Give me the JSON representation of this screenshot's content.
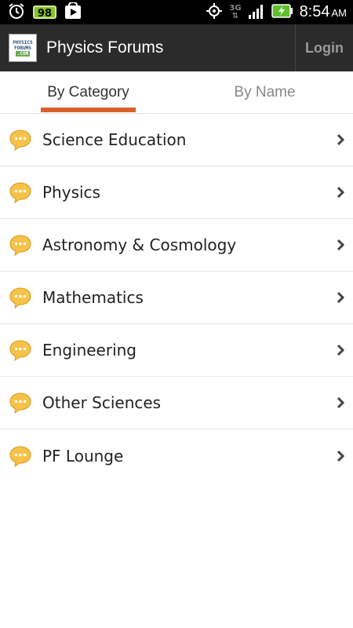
{
  "status_bar": {
    "notification_badge": "98",
    "clock": "8:54",
    "ampm": "AM",
    "network": "3G"
  },
  "action_bar": {
    "logo_text": [
      "PHYSICS",
      "FORUMS",
      ".COM"
    ],
    "title": "Physics Forums",
    "login_label": "Login"
  },
  "tabs": [
    {
      "label": "By Category",
      "active": true
    },
    {
      "label": "By Name",
      "active": false
    }
  ],
  "categories": [
    {
      "label": "Science Education"
    },
    {
      "label": "Physics"
    },
    {
      "label": "Astronomy & Cosmology"
    },
    {
      "label": "Mathematics"
    },
    {
      "label": "Engineering"
    },
    {
      "label": "Other Sciences"
    },
    {
      "label": "PF Lounge"
    }
  ],
  "colors": {
    "accent": "#d9622b",
    "action_bar": "#2b2b2b",
    "bubble": "#f6c24a"
  }
}
